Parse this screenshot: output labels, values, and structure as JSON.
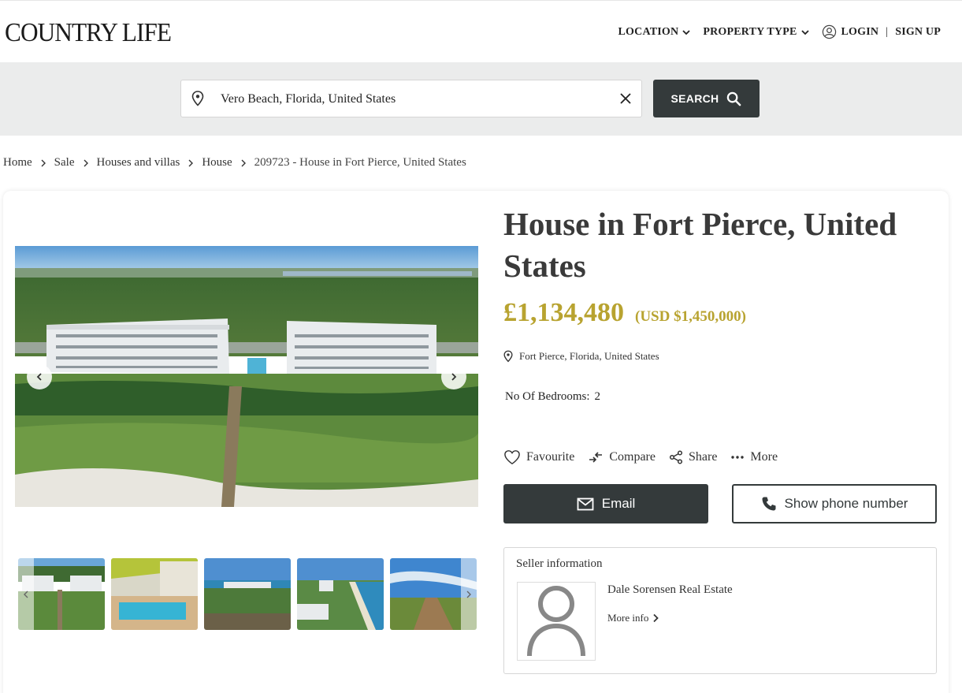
{
  "header": {
    "logo": "COUNTRY LIFE",
    "nav": {
      "location": "LOCATION",
      "property_type": "PROPERTY TYPE",
      "login": "LOGIN",
      "separator": "|",
      "signup": "SIGN UP"
    }
  },
  "search": {
    "value": "Vero Beach, Florida, United States",
    "button_label": "SEARCH"
  },
  "breadcrumb": {
    "items": [
      "Home",
      "Sale",
      "Houses and villas",
      "House"
    ],
    "current": "209723 - House in Fort Pierce, United States"
  },
  "listing": {
    "title": "House in Fort Pierce, United States",
    "price": "£1,134,480",
    "price_usd": "(USD $1,450,000)",
    "location": "Fort Pierce, Florida, United States",
    "bedrooms_label": "No Of Bedrooms:",
    "bedrooms_value": "2"
  },
  "actions": {
    "favourite": "Favourite",
    "compare": "Compare",
    "share": "Share",
    "more": "More"
  },
  "buttons": {
    "email": "Email",
    "phone": "Show phone number"
  },
  "seller": {
    "heading": "Seller information",
    "name": "Dale Sorensen Real Estate",
    "more_info": "More info"
  },
  "colors": {
    "dark": "#343a3b",
    "gold": "#b8a330",
    "band": "#ebecec"
  }
}
